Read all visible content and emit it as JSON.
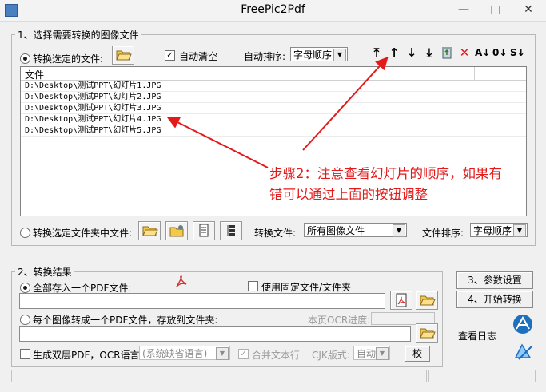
{
  "window": {
    "title": "FreePic2Pdf"
  },
  "section1": {
    "title": "1、选择需要转换的图像文件",
    "radio_selected_files": "转换选定的文件:",
    "auto_clear": "自动清空",
    "auto_sort_label": "自动排序:",
    "auto_sort_value": "字母顺序",
    "file_list": {
      "column_header": "文件",
      "rows": [
        "D:\\Desktop\\测试PPT\\幻灯片1.JPG",
        "D:\\Desktop\\测试PPT\\幻灯片2.JPG",
        "D:\\Desktop\\测试PPT\\幻灯片3.JPG",
        "D:\\Desktop\\测试PPT\\幻灯片4.JPG",
        "D:\\Desktop\\测试PPT\\幻灯片5.JPG"
      ]
    },
    "radio_folder": "转换选定文件夹中文件:",
    "convert_files_label": "转换文件:",
    "convert_files_value": "所有图像文件",
    "file_sort_label": "文件排序:",
    "file_sort_value": "字母顺序"
  },
  "annotation": {
    "line1": "步骤2：注意查看幻灯片的顺序，如果有",
    "line2": "错可以通过上面的按钮调整",
    "color": "#e3191a"
  },
  "section2": {
    "title": "2、转换结果",
    "radio_single_pdf": "全部存入一个PDF文件:",
    "use_fixed": "使用固定文件/文件夹",
    "radio_each_pdf": "每个图像转成一个PDF文件，存放到文件夹:",
    "ocr_progress_label": "本页OCR进度:",
    "dual_layer": "生成双层PDF，OCR语言:",
    "ocr_lang_value": "(系统缺省语言)",
    "merge_lines": "合并文本行",
    "cjk_label": "CJK版式:",
    "cjk_value": "自动",
    "check_button": "校"
  },
  "actions": {
    "param_settings": "3、参数设置",
    "start_convert": "4、开始转换",
    "view_log": "查看日志"
  },
  "colors": {
    "annotation": "#e3191a",
    "accent": "#1f6fbf"
  }
}
